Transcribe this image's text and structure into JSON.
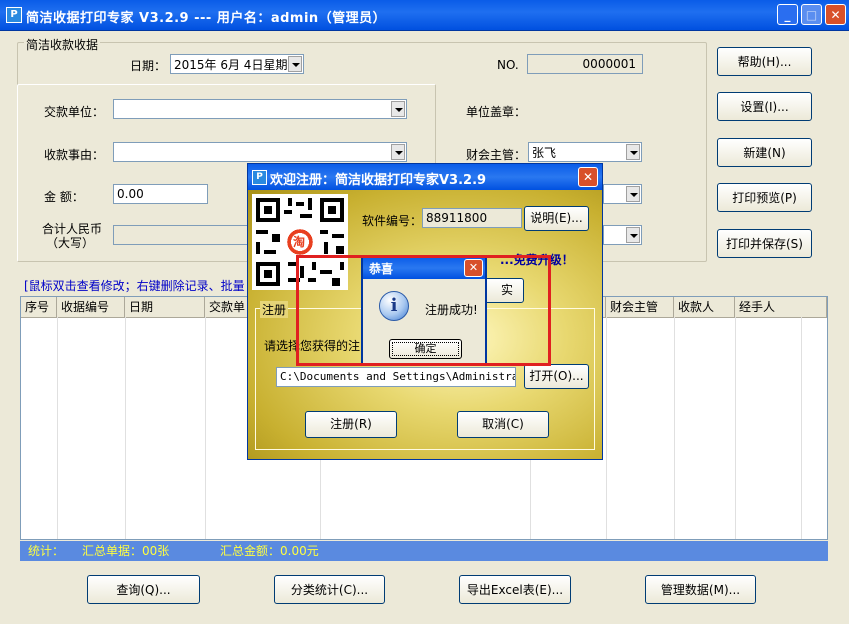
{
  "window": {
    "title": "简洁收据打印专家 V3.2.9 --- 用户名：admin（管理员）",
    "icon_letter": "P"
  },
  "form": {
    "group_label": "简洁收款收据",
    "date_label": "日期：",
    "date_value": "2015年  6月  4日星期",
    "no_label": "NO.",
    "no_value": "0000001",
    "payer_label": "交款单位：",
    "payer_value": "",
    "reason_label": "收款事由：",
    "reason_value": "",
    "amount_label": "金    额：",
    "amount_value": "0.00",
    "rmb_label_line1": "合计人民币",
    "rmb_label_line2": "（大写）",
    "rmb_value": "",
    "seal_label": "单位盖章：",
    "finance_label": "财会主管：",
    "finance_value": "张飞"
  },
  "side_buttons": {
    "help": "帮助(H)...",
    "settings": "设置(I)...",
    "new": "新建(N)",
    "print_preview": "打印预览(P)",
    "print_save": "打印并保存(S)"
  },
  "hint": "[鼠标双击查看修改；右键删除记录、批量",
  "table": {
    "columns": [
      "序号",
      "收据编号",
      "日期",
      "交款单",
      "",
      "",
      "",
      "",
      "",
      "财会主管",
      "收款人",
      "经手人"
    ]
  },
  "status": {
    "stat_label": "统计：",
    "count_text": "汇总单据：00张",
    "amount_text": "汇总金额：0.00元"
  },
  "bottom_buttons": {
    "query": "查询(Q)...",
    "category_stats": "分类统计(C)...",
    "export_excel": "导出Excel表(E)...",
    "manage_data": "管理数据(M)..."
  },
  "reg_dialog": {
    "title": "欢迎注册：简洁收据打印专家V3.2.9",
    "software_no_label": "软件编号：",
    "software_no_value": "88911800",
    "explain_button": "说明(E)...",
    "upgrade_text": "...免费升级！",
    "partial_button": "实",
    "group_label": "注册",
    "select_prompt": "请选择您获得的注",
    "path_value": "C:\\Documents and Settings\\Administrator\\",
    "open_button": "打开(O)...",
    "register_button": "注册(R)",
    "cancel_button": "取消(C)",
    "qr_badge": "淘"
  },
  "success_dialog": {
    "title": "恭喜",
    "message": "注册成功!",
    "ok_button": "确定"
  },
  "colors": {
    "title_blue": "#0a5ce8",
    "highlight_red": "#e02020",
    "status_yellow": "#ffff40",
    "hint_blue": "#0000c8"
  }
}
